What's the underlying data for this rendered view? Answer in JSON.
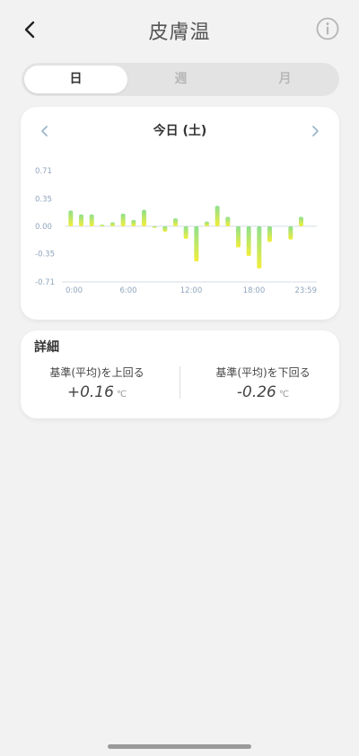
{
  "header": {
    "title": "皮膚温"
  },
  "segment": {
    "items": [
      "日",
      "週",
      "月"
    ],
    "selected": 0
  },
  "chart_card": {
    "date_label": "今日 (土)"
  },
  "chart_data": {
    "type": "bar",
    "title": "",
    "xlabel": "",
    "ylabel": "",
    "ylim": [
      -0.71,
      0.71
    ],
    "y_ticks": [
      "0.71",
      "0.35",
      "0.00",
      "-0.35",
      "-0.71"
    ],
    "x_ticks": [
      "0:00",
      "6:00",
      "12:00",
      "18:00",
      "23:59"
    ],
    "x_range_hours": [
      0,
      24
    ],
    "bars": [
      {
        "hour": 0.5,
        "value": 0.2
      },
      {
        "hour": 1.5,
        "value": 0.15
      },
      {
        "hour": 2.5,
        "value": 0.15
      },
      {
        "hour": 3.5,
        "value": 0.02
      },
      {
        "hour": 4.5,
        "value": 0.05
      },
      {
        "hour": 5.5,
        "value": 0.16
      },
      {
        "hour": 6.5,
        "value": 0.08
      },
      {
        "hour": 7.5,
        "value": 0.21
      },
      {
        "hour": 8.5,
        "value": -0.02
      },
      {
        "hour": 9.5,
        "value": -0.07
      },
      {
        "hour": 10.5,
        "value": 0.1
      },
      {
        "hour": 11.5,
        "value": -0.16
      },
      {
        "hour": 12.5,
        "value": -0.45
      },
      {
        "hour": 13.5,
        "value": 0.06
      },
      {
        "hour": 14.5,
        "value": 0.26
      },
      {
        "hour": 15.5,
        "value": 0.12
      },
      {
        "hour": 16.5,
        "value": -0.27
      },
      {
        "hour": 17.5,
        "value": -0.38
      },
      {
        "hour": 18.5,
        "value": -0.54
      },
      {
        "hour": 19.5,
        "value": -0.2
      },
      {
        "hour": 21.5,
        "value": -0.17
      },
      {
        "hour": 22.5,
        "value": 0.12
      }
    ],
    "colors": {
      "top": "#8fe08f",
      "bottom": "#f2ee3a",
      "grid": "#d6dde4",
      "tick": "#8fa5bd"
    }
  },
  "detail": {
    "title": "詳細",
    "above": {
      "label": "基準(平均)を上回る",
      "value": "+0.16",
      "unit": "℃"
    },
    "below": {
      "label": "基準(平均)を下回る",
      "value": "-0.26",
      "unit": "℃"
    }
  },
  "icons": {
    "back": "chevron-left-icon",
    "info": "info-circle-icon",
    "prev": "chevron-left-icon",
    "next": "chevron-right-icon"
  }
}
